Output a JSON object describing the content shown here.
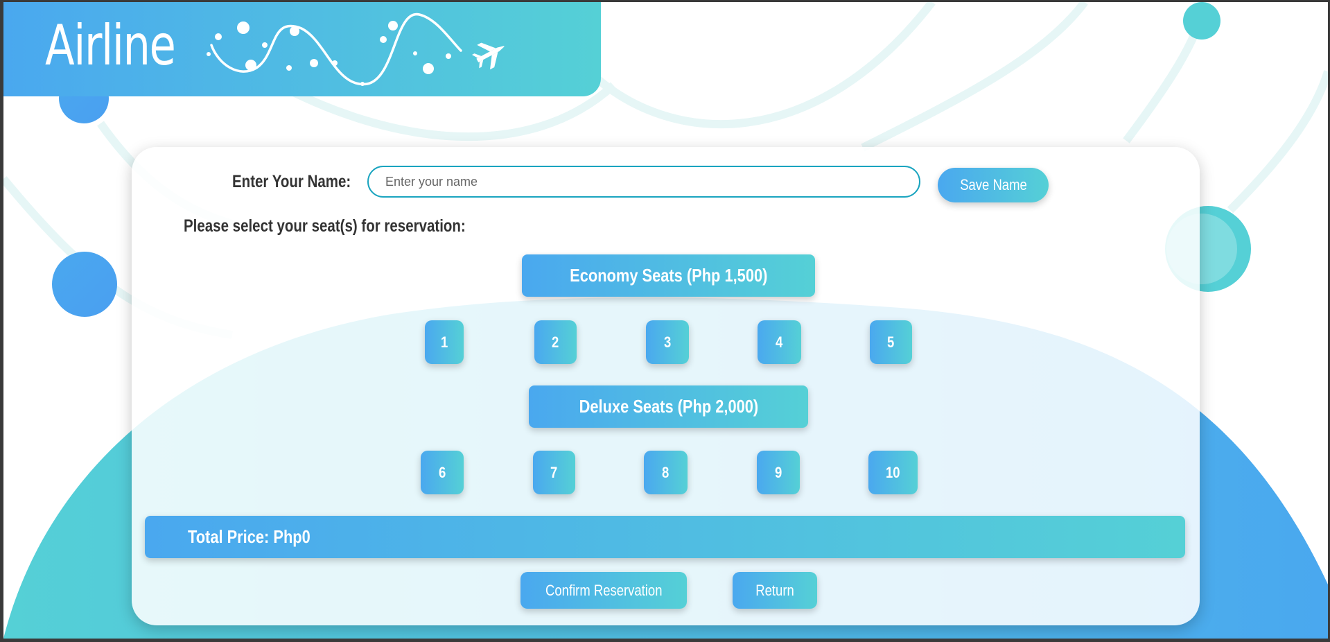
{
  "header": {
    "logo_text": "Airline"
  },
  "form": {
    "name_label": "Enter Your Name:",
    "name_placeholder": "Enter your name",
    "name_value": "",
    "save_button": "Save Name",
    "select_prompt": "Please select your seat(s) for reservation:"
  },
  "economy": {
    "title": "Economy Seats (Php 1,500)",
    "seats": [
      "1",
      "2",
      "3",
      "4",
      "5"
    ]
  },
  "deluxe": {
    "title": "Deluxe Seats (Php 2,000)",
    "seats": [
      "6",
      "7",
      "8",
      "9",
      "10"
    ]
  },
  "summary": {
    "total_label": "Total Price: Php0"
  },
  "actions": {
    "confirm": "Confirm Reservation",
    "return": "Return"
  },
  "colors": {
    "gradient_start": "#4aa8ef",
    "gradient_end": "#55d0d6",
    "input_border": "#1aa4bf"
  },
  "icons": [
    "airplane-icon",
    "wave-dots-decoration"
  ]
}
